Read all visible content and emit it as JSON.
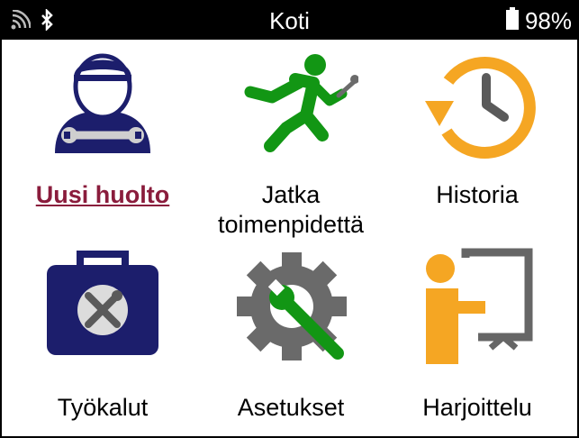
{
  "status_bar": {
    "title": "Koti",
    "battery_level": "98%",
    "icons": [
      "signal-icon",
      "bluetooth-icon",
      "battery-icon"
    ]
  },
  "menu": {
    "items": [
      {
        "label": "Uusi huolto",
        "icon": "mechanic-icon",
        "selected": true
      },
      {
        "label": "Jatka\ntoimenpidettä",
        "icon": "running-man-wrench-icon",
        "selected": false
      },
      {
        "label": "Historia",
        "icon": "history-clock-icon",
        "selected": false
      },
      {
        "label": "Työkalut",
        "icon": "toolbox-icon",
        "selected": false
      },
      {
        "label": "Asetukset",
        "icon": "gear-wrench-icon",
        "selected": false
      },
      {
        "label": "Harjoittelu",
        "icon": "presentation-icon",
        "selected": false
      }
    ]
  },
  "colors": {
    "navy": "#1c1e6c",
    "green": "#129614",
    "orange": "#f5a623",
    "gray": "#606060",
    "selected_text": "#8a1c3c"
  }
}
